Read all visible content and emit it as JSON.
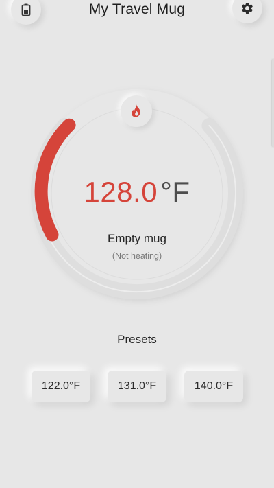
{
  "header": {
    "title": "My Travel Mug",
    "battery_icon": "battery-icon",
    "settings_icon": "gear-icon"
  },
  "dial": {
    "temperature_value": "128.0",
    "temperature_unit": "°F",
    "status": "Empty mug",
    "substatus": "(Not heating)",
    "heater_icon": "flame-icon",
    "accent_color": "#d5443a"
  },
  "presets": {
    "title": "Presets",
    "items": [
      {
        "label": "122.0°F"
      },
      {
        "label": "131.0°F"
      },
      {
        "label": "140.0°F"
      }
    ]
  }
}
